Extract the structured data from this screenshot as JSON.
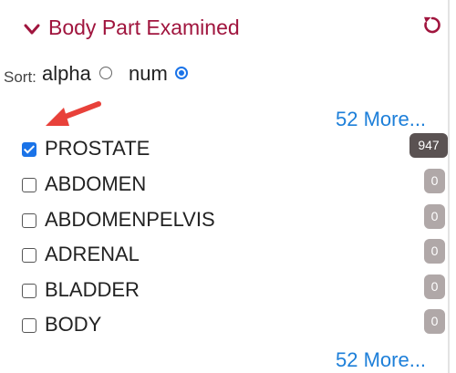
{
  "header": {
    "title": "Body Part Examined",
    "chevron_icon": "chevron-down-icon",
    "reset_icon": "reset-icon",
    "accent_color": "#a0153e"
  },
  "sort": {
    "label": "Sort:",
    "options": [
      {
        "label": "alpha",
        "selected": false
      },
      {
        "label": "num",
        "selected": true
      }
    ]
  },
  "more_top": "52 More...",
  "more_bottom": "52 More...",
  "items": [
    {
      "label": "PROSTATE",
      "count": "947",
      "checked": true
    },
    {
      "label": "ABDOMEN",
      "count": "0",
      "checked": false
    },
    {
      "label": "ABDOMENPELVIS",
      "count": "0",
      "checked": false
    },
    {
      "label": "ADRENAL",
      "count": "0",
      "checked": false
    },
    {
      "label": "BLADDER",
      "count": "0",
      "checked": false
    },
    {
      "label": "BODY",
      "count": "0",
      "checked": false
    }
  ],
  "annotation": {
    "icon": "red-arrow-icon",
    "color": "#e8413a"
  }
}
